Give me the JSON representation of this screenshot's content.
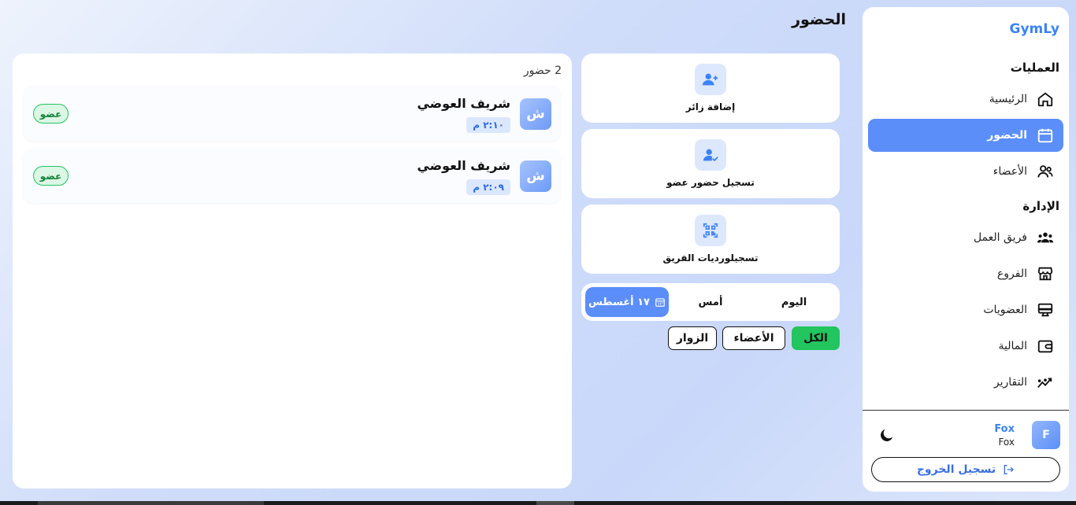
{
  "app": {
    "brand": "GymLy",
    "page_title": "الحضور"
  },
  "sidebar": {
    "section_operations": "العمليات",
    "section_management": "الإدارة",
    "items": [
      {
        "label": "الرئيسية",
        "icon": "home-icon"
      },
      {
        "label": "الحضور",
        "icon": "calendar-icon",
        "active": true
      },
      {
        "label": "الأعضاء",
        "icon": "users-icon"
      },
      {
        "label": "فريق العمل",
        "icon": "team-icon"
      },
      {
        "label": "الفروع",
        "icon": "store-icon"
      },
      {
        "label": "العضويات",
        "icon": "membership-icon"
      },
      {
        "label": "المالية",
        "icon": "wallet-icon"
      },
      {
        "label": "التقارير",
        "icon": "chart-icon"
      }
    ],
    "user": {
      "avatar_letter": "F",
      "name": "Fox",
      "subtitle": "Fox"
    },
    "logout_label": "تسجيل الخروج"
  },
  "actions": [
    {
      "label": "إضافة زائر",
      "icon": "person-add-icon"
    },
    {
      "label": "تسجيل حضور عضو",
      "icon": "person-check-icon"
    },
    {
      "label": "تسجيلورديات الفريق",
      "icon": "qr-code-icon"
    }
  ],
  "date_filter": {
    "today": "اليوم",
    "yesterday": "أمس",
    "selected_date": "١٧ أغسطس"
  },
  "type_filter": {
    "all": "الكل",
    "members": "الأعضاء",
    "visitors": "الزوار"
  },
  "attendance": {
    "count_label": "2 حضور",
    "records": [
      {
        "avatar_letter": "ش",
        "name": "شريف العوضي",
        "time": "٢:١٠ م",
        "badge": "عضو"
      },
      {
        "avatar_letter": "ش",
        "name": "شريف العوضي",
        "time": "٢:٠٩ م",
        "badge": "عضو"
      }
    ]
  },
  "colors": {
    "accent": "#5b8ef8",
    "brand": "#3b82f6",
    "success": "#22c55e"
  }
}
